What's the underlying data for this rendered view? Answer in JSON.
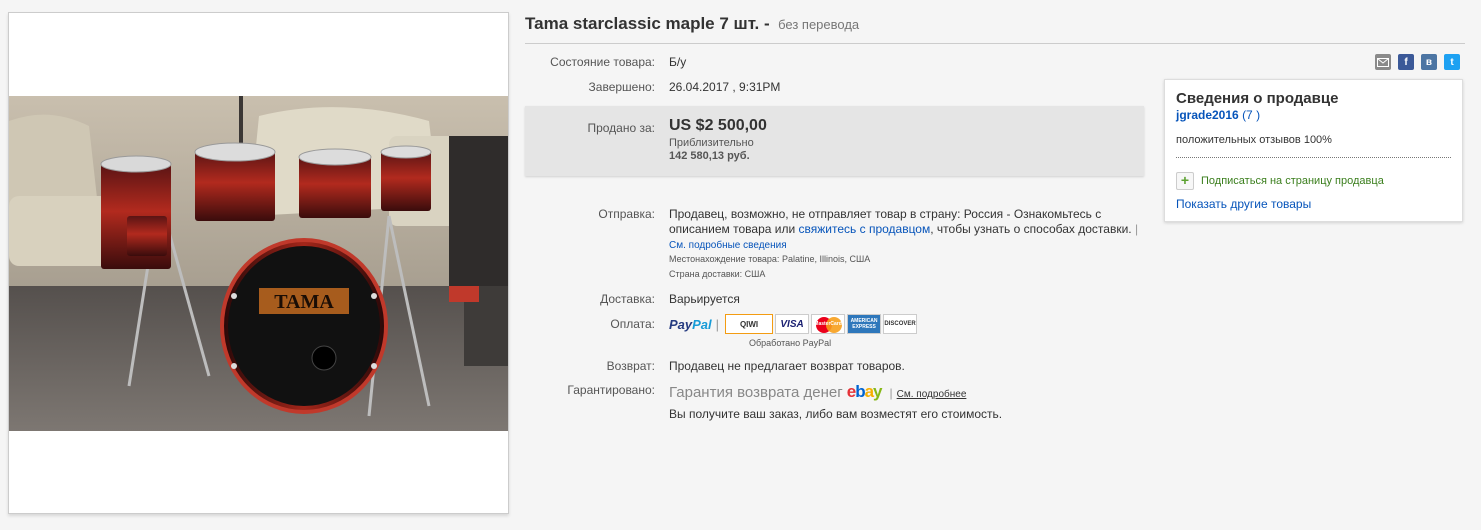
{
  "title": {
    "text": "Tama starclassic maple 7 шт. -",
    "suffix": "без перевода"
  },
  "details": {
    "condition_label": "Состояние товара:",
    "condition_value": "Б/у",
    "ended_label": "Завершено:",
    "ended_value": "26.04.2017 , 9:31PM"
  },
  "price": {
    "label": "Продано за:",
    "amount": "US $2 500,00",
    "approx_label": "Приблизительно",
    "converted": "142 580,13 руб."
  },
  "shipping": {
    "label": "Отправка:",
    "text_before": "Продавец, возможно, не отправляет товар в страну: Россия - Ознакомьтесь с описанием товара или ",
    "contact_link": "свяжитесь с продавцом",
    "text_after": ", чтобы узнать о способах доставки.",
    "details_link": "См. подробные сведения",
    "location_label": "Местонахождение товара:",
    "location_value": "Palatine, Illinois, США",
    "ship_to_label": "Страна доставки:",
    "ship_to_value": "США"
  },
  "delivery": {
    "label": "Доставка:",
    "value": "Варьируется"
  },
  "payment": {
    "label": "Оплата:",
    "paypal_a": "Pay",
    "paypal_b": "Pal",
    "card_names": [
      "QIWI",
      "VISA",
      "MasterCard",
      "AMERICAN EXPRESS",
      "DISCOVER"
    ],
    "processed_by": "Обработано PayPal"
  },
  "returns": {
    "label": "Возврат:",
    "value": "Продавец не предлагает возврат товаров."
  },
  "guarantee": {
    "label": "Гарантировано:",
    "text": "Гарантия возврата денег",
    "ebay_e": "e",
    "ebay_b": "b",
    "ebay_a": "a",
    "ebay_y": "y",
    "more_link": "См. подробнее",
    "note": "Вы получите ваш заказ, либо вам возместят его стоимость."
  },
  "share": {
    "icons": [
      "email-icon",
      "facebook-icon",
      "vk-icon",
      "twitter-icon"
    ],
    "fb_glyph": "f",
    "vk_glyph": "в",
    "tw_glyph": "t"
  },
  "seller": {
    "title": "Сведения о продавце",
    "name": "jgrade2016",
    "feedback_count": "(7 )",
    "positive": "положительных отзывов 100%",
    "follow_icon": "+",
    "follow": "Подписаться на страницу продавца",
    "other_items": "Показать другие товары"
  },
  "photo": {
    "brand_on_drum": "TAMA"
  },
  "colors": {
    "link": "#0654ba",
    "price_box": "#e5e5e5",
    "follow_green": "#3a7e1c"
  }
}
